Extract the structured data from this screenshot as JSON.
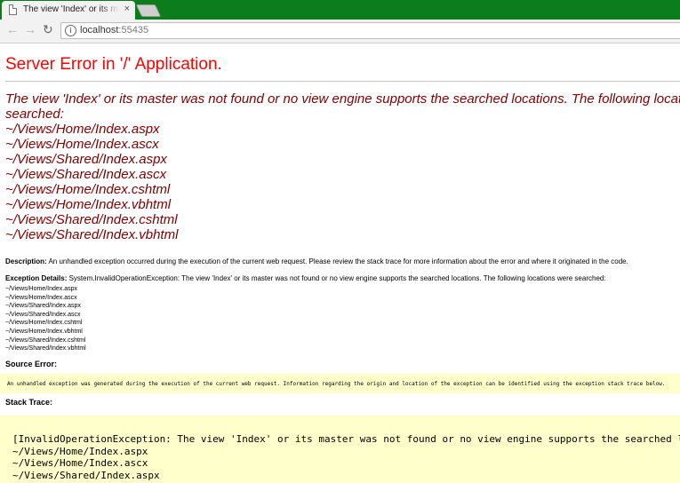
{
  "browser": {
    "tab_title": "The view 'Index' or its master was not found",
    "tab_close": "×",
    "url_host": "localhost",
    "url_port": ":55435"
  },
  "page": {
    "title": "Server Error in '/' Application.",
    "heading_lines": [
      "The view 'Index' or its master was not found or no view engine supports the searched locations. The following locations were",
      "searched:",
      "~/Views/Home/Index.aspx",
      "~/Views/Home/Index.ascx",
      "~/Views/Shared/Index.aspx",
      "~/Views/Shared/Index.ascx",
      "~/Views/Home/Index.cshtml",
      "~/Views/Home/Index.vbhtml",
      "~/Views/Shared/Index.cshtml",
      "~/Views/Shared/Index.vbhtml"
    ],
    "description_label": "Description:",
    "description_text": "An unhandled exception occurred during the execution of the current web request. Please review the stack trace for more information about the error and where it originated in the code.",
    "exception_label": "Exception Details:",
    "exception_text": "System.InvalidOperationException: The view 'Index' or its master was not found or no view engine supports the searched locations. The following locations were searched:",
    "locations": [
      "~/Views/Home/Index.aspx",
      "~/Views/Home/Index.ascx",
      "~/Views/Shared/Index.aspx",
      "~/Views/Shared/Index.ascx",
      "~/Views/Home/Index.cshtml",
      "~/Views/Home/Index.vbhtml",
      "~/Views/Shared/Index.cshtml",
      "~/Views/Shared/Index.vbhtml"
    ],
    "source_error_label": "Source Error:",
    "source_error_text": "An unhandled exception was generated during the execution of the current web request. Information regarding the origin and location of the exception can be identified using the exception stack trace below.",
    "stack_trace_label": "Stack Trace:",
    "stack_lines": [
      "[InvalidOperationException: The view 'Index' or its master was not found or no view engine supports the searched locations. The following locations were searched:",
      "~/Views/Home/Index.aspx",
      "~/Views/Home/Index.ascx",
      "~/Views/Shared/Index.aspx"
    ]
  }
}
